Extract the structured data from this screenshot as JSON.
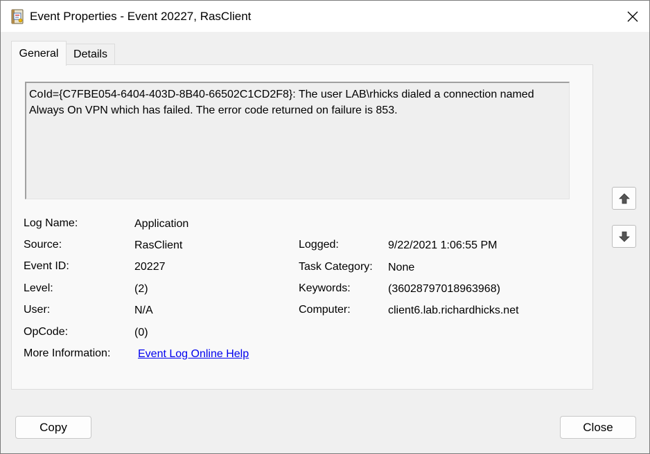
{
  "window": {
    "title": "Event Properties - Event 20227, RasClient"
  },
  "tabs": [
    {
      "label": "General",
      "active": true
    },
    {
      "label": "Details",
      "active": false
    }
  ],
  "description": "CoId={C7FBE054-6404-403D-8B40-66502C1CD2F8}: The user LAB\\rhicks dialed a connection named Always On VPN which has failed. The error code returned on failure is 853.",
  "fields": {
    "log_name": {
      "label": "Log Name:",
      "value": "Application"
    },
    "source": {
      "label": "Source:",
      "value": "RasClient"
    },
    "event_id": {
      "label": "Event ID:",
      "value": "20227"
    },
    "level": {
      "label": "Level:",
      "value": "(2)"
    },
    "user": {
      "label": "User:",
      "value": "N/A"
    },
    "opcode": {
      "label": "OpCode:",
      "value": "(0)"
    },
    "more_info": {
      "label": "More Information:",
      "value": "Event Log Online Help"
    },
    "logged": {
      "label": "Logged:",
      "value": "9/22/2021 1:06:55 PM"
    },
    "task_category": {
      "label": "Task Category:",
      "value": "None"
    },
    "keywords": {
      "label": "Keywords:",
      "value": "(36028797018963968)"
    },
    "computer": {
      "label": "Computer:",
      "value": "client6.lab.richardhicks.net"
    }
  },
  "buttons": {
    "copy": "Copy",
    "close": "Close"
  },
  "icons": {
    "app": "event-viewer-icon",
    "close": "close-icon",
    "up": "arrow-up-icon",
    "down": "arrow-down-icon"
  }
}
